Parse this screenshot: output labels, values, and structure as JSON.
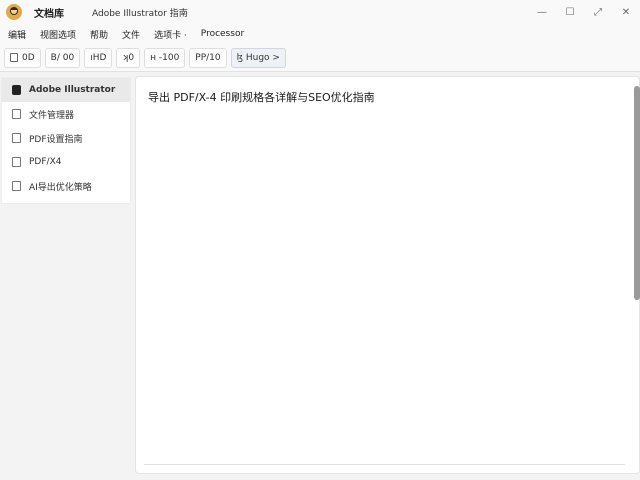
{
  "window": {
    "app_name": "文档库",
    "doc_title": "Adobe Illustrator 指南",
    "minimize": "—",
    "maximize": "☐",
    "close": "✕"
  },
  "menu": [
    "编辑",
    "视图选项",
    "帮助",
    "文件",
    "选项卡 ·",
    "Processor"
  ],
  "toolbar": [
    {
      "label": "0D",
      "icon": "document-icon"
    },
    {
      "label": "B/ 00",
      "icon": "none"
    },
    {
      "label": "ıHD",
      "icon": "none"
    },
    {
      "label": "ʞ0",
      "icon": "bracket-icon"
    },
    {
      "label": "ʜ -100",
      "icon": "bracket-icon"
    },
    {
      "label": "PP/10",
      "icon": "none"
    },
    {
      "label": "ɮ Hugo >",
      "icon": "link-icon"
    }
  ],
  "sidebar": {
    "items": [
      {
        "label": "Adobe Illustrator",
        "selected": true
      },
      {
        "label": "文件管理器",
        "selected": false
      },
      {
        "label": "PDF设置指南",
        "selected": false
      },
      {
        "label": "PDF/X4",
        "selected": false
      },
      {
        "label": "AI导出优化策略",
        "selected": false
      }
    ]
  },
  "main": {
    "title": "导出 PDF/X-4 印刷规格各详解与SEO优化指南"
  }
}
